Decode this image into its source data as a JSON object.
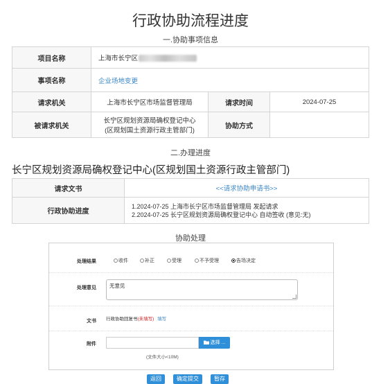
{
  "page": {
    "title": "行政协助流程进度",
    "section1_title": "一.协助事项信息",
    "section2_title": "二.办理进度",
    "dept_heading": "长宁区规划资源局确权登记中心(区规划国土资源行政主管部门)",
    "section3_title": "协助处理"
  },
  "info": {
    "project_label": "项目名称",
    "project_value": "上海市长宁区",
    "matter_label": "事项名称",
    "matter_value": "企业场地变更",
    "requester_label": "请求机关",
    "requester_value": "上海市长宁区市场监督管理局",
    "request_time_label": "请求时间",
    "request_time_value": "2024-07-25",
    "requested_label": "被请求机关",
    "requested_value_line1": "长宁区规划资源局确权登记中心",
    "requested_value_line2": "(区规划国土资源行政主管部门)",
    "method_label": "协助方式",
    "method_value": ""
  },
  "progress": {
    "doc_label": "请求文书",
    "doc_link": "<<请求协助申请书>>",
    "progress_label": "行政协助进度",
    "lines": [
      "1.2024-07-25 上海市长宁区市场监督管理局 发起请求",
      "2.2024-07-25 长宁区规划资源局确权登记中心 自动签收 (意见:无)"
    ]
  },
  "form": {
    "result_label": "处理结果",
    "options": [
      "收件",
      "补正",
      "受理",
      "不予受理",
      "告场决定"
    ],
    "selected_index": 4,
    "opinion_label": "处理意见",
    "opinion_value": "无意见",
    "doc_label": "文书",
    "doc_text_prefix": "行政协助回复书",
    "doc_text_status": "(未填写)",
    "doc_edit_link": "填写",
    "attach_label": "附件",
    "attach_button": "选择 ...",
    "attach_hint": "(文件大小<10M)"
  },
  "buttons": {
    "back": "返回",
    "confirm": "确定提交",
    "hold": "暂存"
  },
  "colors": {
    "accent": "#2f8fd8",
    "link": "#3a87c8",
    "warning": "#d02020",
    "border": "#d5d5d5"
  },
  "icons": {
    "folder": "folder-icon"
  }
}
